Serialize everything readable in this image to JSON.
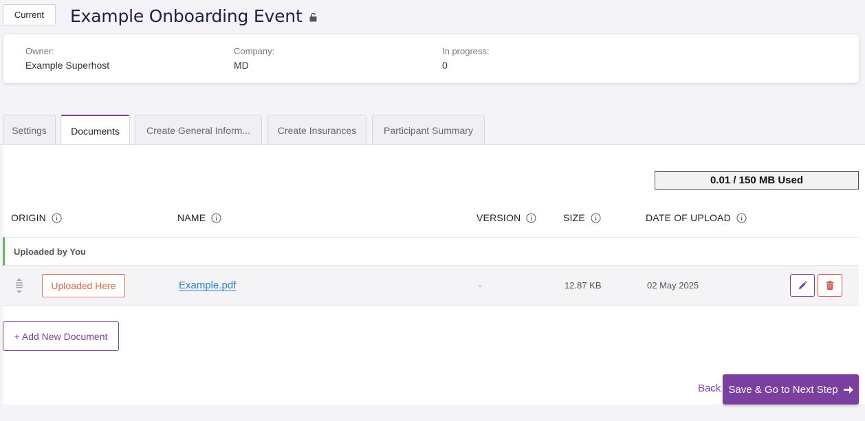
{
  "header": {
    "status_badge": "Current",
    "title": "Example Onboarding Event"
  },
  "info": {
    "owner_label": "Owner:",
    "owner_value": "Example Superhost",
    "company_label": "Company:",
    "company_value": "MD",
    "progress_label": "In progress:",
    "progress_value": "0"
  },
  "tabs": [
    {
      "label": "Settings"
    },
    {
      "label": "Documents"
    },
    {
      "label": "Create General Inform..."
    },
    {
      "label": "Create Insurances"
    },
    {
      "label": "Participant Summary"
    }
  ],
  "storage": {
    "used_text": "0.01 / 150 MB Used"
  },
  "table": {
    "columns": [
      "ORIGIN",
      "NAME",
      "VERSION",
      "SIZE",
      "DATE OF UPLOAD"
    ],
    "group_label": "Uploaded by You",
    "rows": [
      {
        "origin": "Uploaded Here",
        "name": "Example.pdf",
        "version": "-",
        "size": "12.87 KB",
        "date": "02 May 2025"
      }
    ]
  },
  "actions": {
    "add_document": "+ Add New Document",
    "back": "Back",
    "save_next": "Save & Go to Next Step"
  },
  "colors": {
    "accent": "#7b3fa0",
    "link": "#2a7fd0",
    "origin_badge": "#e0674a",
    "group_marker": "#5cb85c",
    "delete": "#d9534f"
  },
  "icons": {
    "title_lock": "unlock-icon",
    "column_info": "info-circle-icon",
    "drag": "drag-handle-icon",
    "edit": "pencil-icon",
    "delete": "trash-icon",
    "next": "arrow-right-icon"
  }
}
